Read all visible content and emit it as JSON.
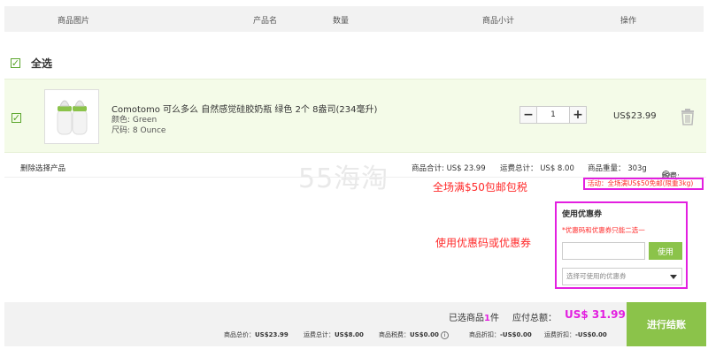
{
  "header": {
    "col_image": "商品图片",
    "col_name": "产品名",
    "col_qty": "数量",
    "col_subtotal": "商品小计",
    "col_action": "操作"
  },
  "select_all": {
    "label": "全选",
    "checked": true
  },
  "item": {
    "checked": true,
    "title": "Comotomo 可么多么 自然感觉硅胶奶瓶 绿色 2个 8盎司(234毫升)",
    "color_label": "颜色: Green",
    "size_label": "尺码: 8 Ounce",
    "quantity": "1",
    "minus": "−",
    "plus": "+",
    "price": "US$23.99",
    "trash_icon": "trash-icon"
  },
  "summary": {
    "delete_selected": "删除选择产品",
    "goods_total": "商品合计: US$ 23.99",
    "shipping_total": "运费总计： US$ 8.00",
    "weight": "商品重量： 303g",
    "tax": "税费:"
  },
  "watermark": "55海淘",
  "annotations": {
    "promo_note": "全场满$50包邮包税",
    "coupon_note": "使用优惠码或优惠券"
  },
  "activity": "活动：全场满US$50免邮(限重3kg)",
  "coupon": {
    "title": "使用优惠券",
    "hint": "*优惠码和优惠券只能二选一",
    "input_placeholder": "",
    "use_button": "使用",
    "select_placeholder": "选择可使用的优惠券"
  },
  "footer": {
    "selected_prefix": "已选商品",
    "selected_count": "1",
    "selected_suffix": "件",
    "total_label": "应付总额：",
    "total_value": "US$ 31.99",
    "d1_label": "商品总价：",
    "d1_value": "US$23.99",
    "d2_label": "运费总计：",
    "d2_value": "US$8.00",
    "d3_label": "商品税费：",
    "d3_value": "US$0.00",
    "d4_label": "商品折扣：",
    "d4_value": "-US$0.00",
    "d5_label": "运费折扣：",
    "d5_value": "-US$0.00",
    "checkout": "进行结账"
  },
  "colors": {
    "accent_green": "#8bc34a",
    "highlight_magenta": "#e31fe0",
    "promo_red": "#ff2a2a"
  }
}
